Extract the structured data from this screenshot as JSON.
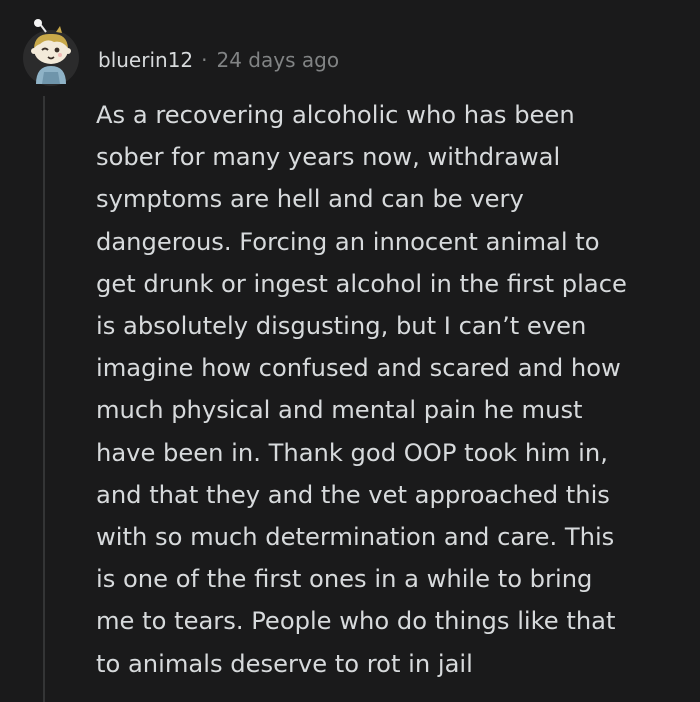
{
  "comment": {
    "username": "bluerin12",
    "separator": "·",
    "timestamp": "24 days ago",
    "body_lines": [
      "As a recovering alcoholic who has been",
      "sober for many years now, withdrawal",
      "symptoms are hell and can be very",
      "dangerous. Forcing an innocent animal to",
      "get drunk or ingest alcohol in the first place",
      "is absolutely disgusting, but I can’t even",
      "imagine how confused and scared and how",
      "much physical and mental pain he must",
      "have been in. Thank god OOP took him in,",
      "and that they and the vet approached this",
      "with so much determination and care. This",
      "is one of the first ones in a while to bring",
      "me to tears. People who do things like that",
      "to animals deserve to rot in jail"
    ]
  },
  "colors": {
    "background": "#1a1a1b",
    "text": "#d7dadc",
    "meta_text": "#818384",
    "thread_line": "#343536"
  },
  "icons": {
    "avatar": "snoo-avatar-icon"
  }
}
